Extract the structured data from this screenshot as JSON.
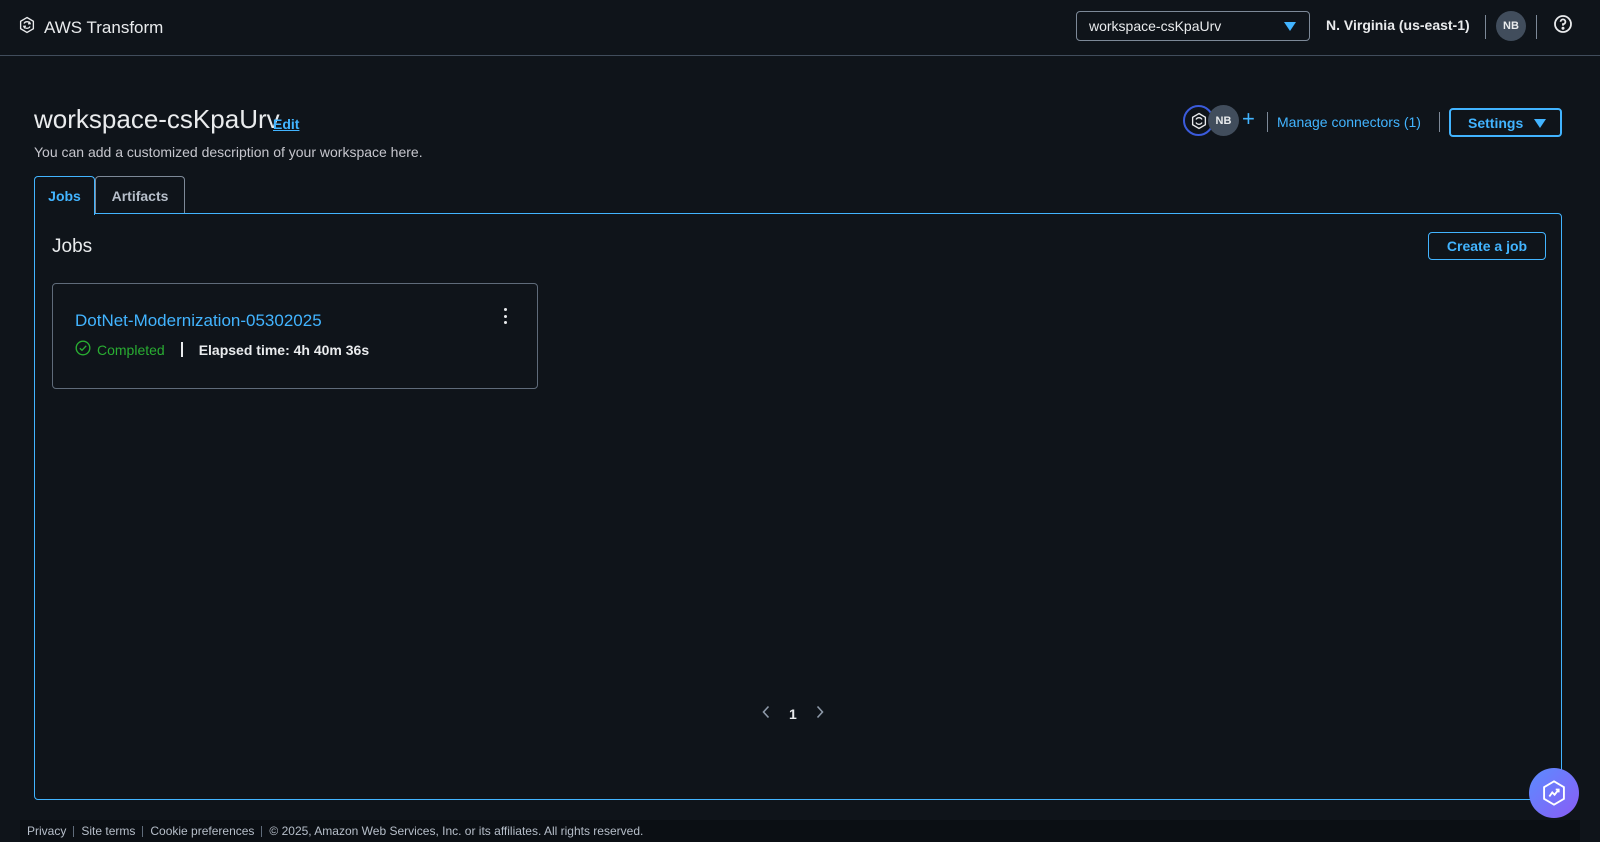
{
  "app": {
    "title": "AWS Transform"
  },
  "topbar": {
    "workspace_selected": "workspace-csKpaUrv",
    "region": "N. Virginia (us-east-1)",
    "user_initials": "NB"
  },
  "workspace": {
    "name": "workspace-csKpaUrv",
    "edit_label": "Edit",
    "description": "You can add a customized description of your workspace here.",
    "member_initials": "NB",
    "manage_connectors_label": "Manage connectors (1)",
    "settings_label": "Settings"
  },
  "tabs": [
    {
      "label": "Jobs"
    },
    {
      "label": "Artifacts"
    }
  ],
  "jobs_panel": {
    "title": "Jobs",
    "create_label": "Create a job",
    "jobs": [
      {
        "name": "DotNet-Modernization-05302025",
        "status": "Completed",
        "elapsed": "Elapsed time: 4h 40m 36s"
      }
    ],
    "page": "1"
  },
  "footer": {
    "privacy": "Privacy",
    "site_terms": "Site terms",
    "cookie_preferences": "Cookie preferences",
    "copyright": "© 2025, Amazon Web Services, Inc. or its affiliates. All rights reserved."
  },
  "colors": {
    "background": "#0f141a",
    "accent": "#42b4ff",
    "success": "#29ad32",
    "border": "#7d8998"
  },
  "icons": [
    "transform-logo-icon",
    "caret-down-icon",
    "help-icon",
    "connector-icon",
    "plus-icon",
    "success-check-icon",
    "kebab-menu-icon",
    "chevron-left-icon",
    "chevron-right-icon",
    "assistant-chat-icon"
  ]
}
